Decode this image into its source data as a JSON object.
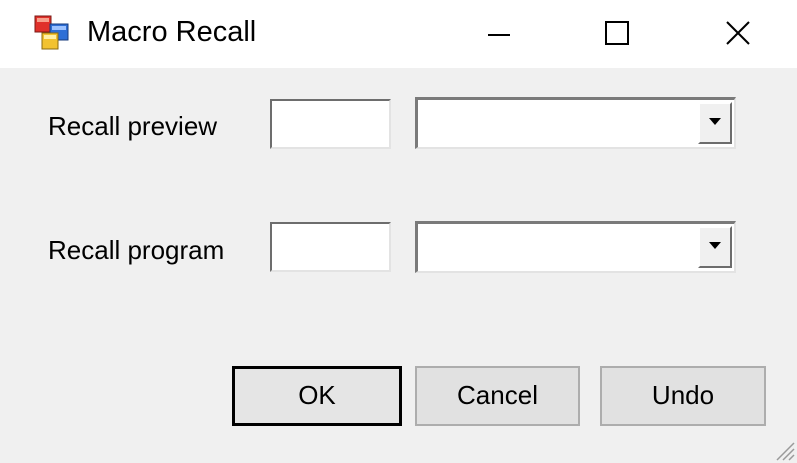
{
  "window": {
    "title": "Macro Recall",
    "icon": "app-window-icon",
    "controls": {
      "minimize": "minimize-icon",
      "maximize": "maximize-icon",
      "close": "close-icon"
    }
  },
  "form": {
    "recall_preview": {
      "label": "Recall preview",
      "number_value": "",
      "combo_value": ""
    },
    "recall_program": {
      "label": "Recall program",
      "number_value": "",
      "combo_value": ""
    }
  },
  "buttons": {
    "ok": "OK",
    "cancel": "Cancel",
    "undo": "Undo"
  },
  "colors": {
    "title_bar": "#ffffff",
    "client_area": "#f0f0f0",
    "button_face": "#e1e1e1",
    "default_button_border": "#000000"
  }
}
